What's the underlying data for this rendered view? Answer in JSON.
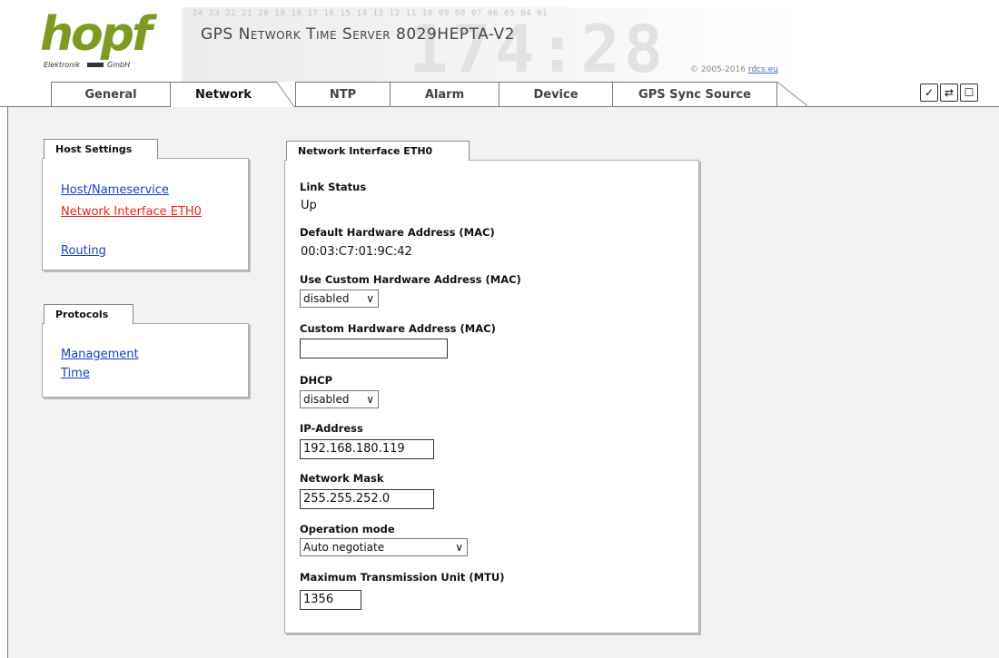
{
  "header": {
    "logo_text": "hopf",
    "logo_sub_left": "Elektronik",
    "logo_sub_right": "GmbH",
    "digit_strip": "24 23 22 21 20 19 18 17 16 15 14 13 12 11 10 09 08 07 06 05 04 01",
    "background_numerals": "174:28",
    "title": "GPS Network Time Server 8029HEPTA-V2",
    "copyright": "© 2005-2016",
    "copyright_link": "rdcs.eu"
  },
  "tabs": [
    {
      "label": "General"
    },
    {
      "label": "Network",
      "active": true
    },
    {
      "label": "NTP"
    },
    {
      "label": "Alarm"
    },
    {
      "label": "Device"
    },
    {
      "label": "GPS Sync Source"
    }
  ],
  "toolbar_icons": [
    "check-icon",
    "refresh-icon",
    "window-icon"
  ],
  "sidebar": {
    "host_settings": {
      "title": "Host Settings",
      "links": [
        {
          "label": "Host/Nameservice"
        },
        {
          "label": "Network Interface ETH0",
          "current": true
        },
        {
          "label": "Routing"
        }
      ]
    },
    "protocols": {
      "title": "Protocols",
      "links": [
        {
          "label": "Management"
        },
        {
          "label": "Time"
        }
      ]
    }
  },
  "panel": {
    "title": "Network Interface ETH0",
    "link_status": {
      "label": "Link Status",
      "value": "Up"
    },
    "default_mac": {
      "label": "Default Hardware Address (MAC)",
      "value": "00:03:C7:01:9C:42"
    },
    "use_custom_mac": {
      "label": "Use Custom Hardware Address (MAC)",
      "value": "disabled"
    },
    "custom_mac": {
      "label": "Custom Hardware Address (MAC)",
      "value": ""
    },
    "dhcp": {
      "label": "DHCP",
      "value": "disabled"
    },
    "ip_address": {
      "label": "IP-Address",
      "value": "192.168.180.119"
    },
    "network_mask": {
      "label": "Network Mask",
      "value": "255.255.252.0"
    },
    "operation_mode": {
      "label": "Operation mode",
      "value": "Auto negotiate"
    },
    "mtu": {
      "label": "Maximum Transmission Unit (MTU)",
      "value": "1356"
    }
  },
  "colors": {
    "logo_green": "#7e9a22",
    "link_blue": "#1a3fc8",
    "link_active_red": "#e8261c",
    "content_bg": "#f2f2f2"
  }
}
